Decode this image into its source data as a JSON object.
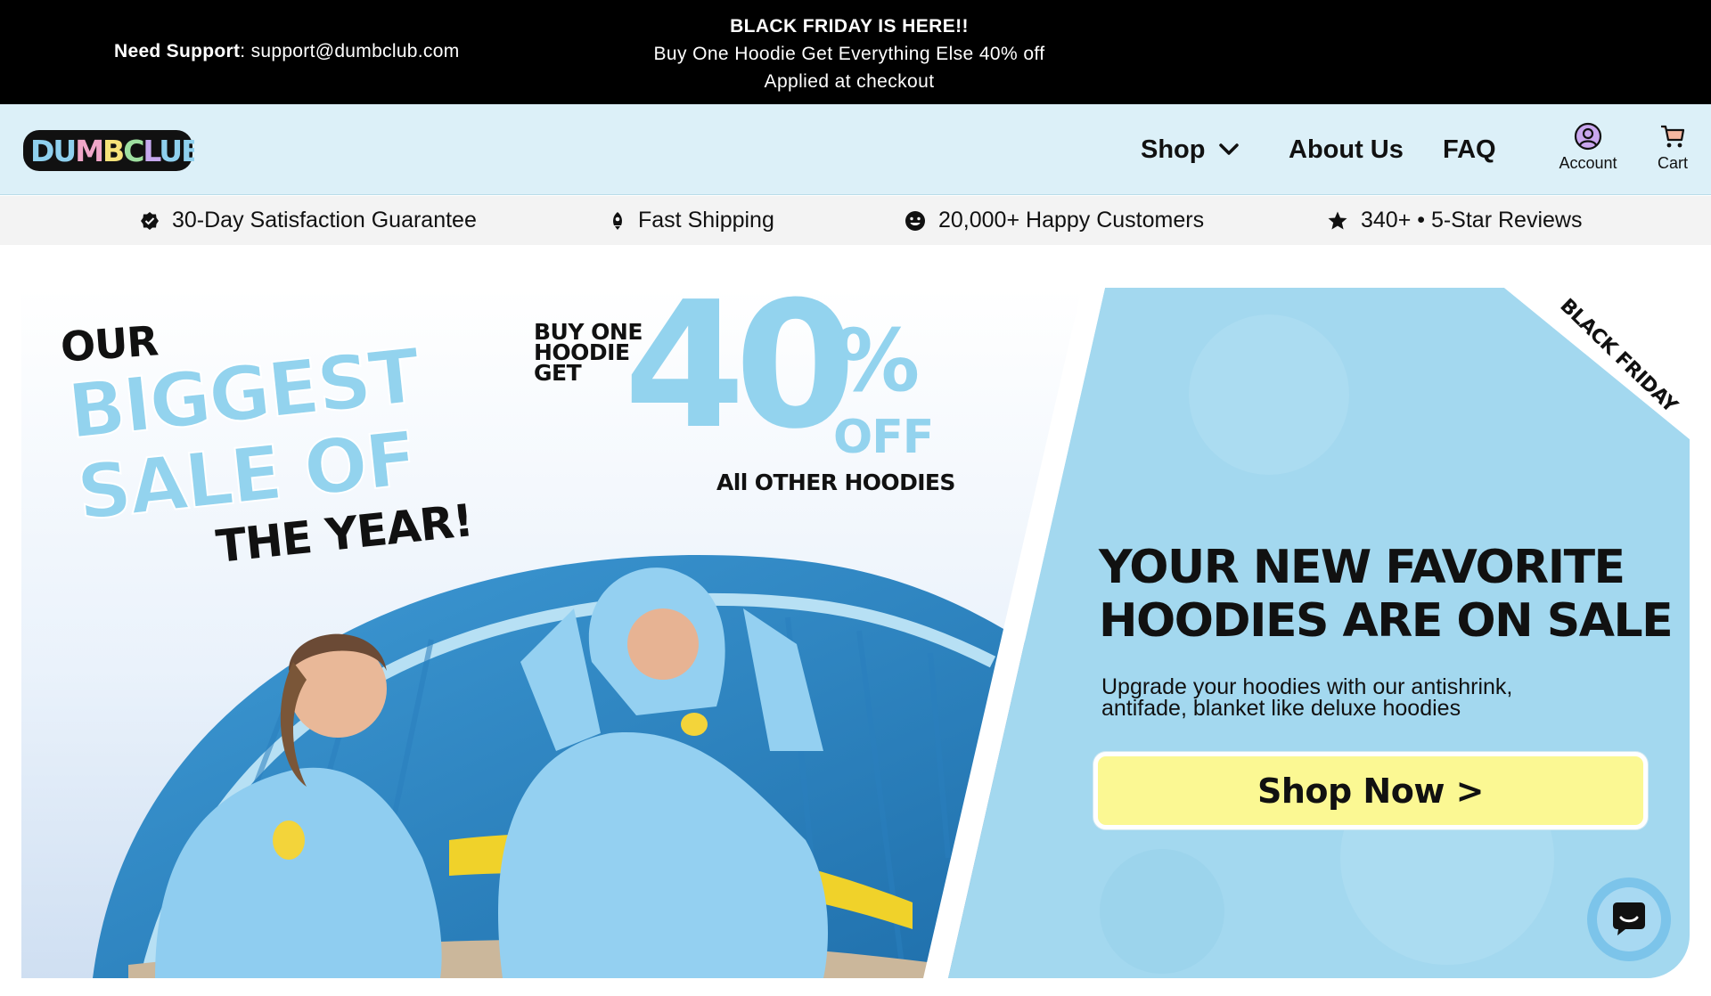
{
  "announcement": {
    "support_label": "Need Support",
    "support_sep": ":",
    "support_email": "support@dumbclub.com",
    "promo_line1": "BLACK FRIDAY IS HERE!!",
    "promo_line2": "Buy One Hoodie Get Everything Else 40% off",
    "promo_line3": "Applied at checkout"
  },
  "header": {
    "logo_text": "DUMBCLUB",
    "nav": [
      {
        "label": "Shop",
        "has_dropdown": true
      },
      {
        "label": "About Us"
      },
      {
        "label": "FAQ"
      }
    ],
    "account_label": "Account",
    "cart_label": "Cart"
  },
  "benefits": [
    {
      "icon": "verified-badge-icon",
      "label": "30-Day Satisfaction Guarantee"
    },
    {
      "icon": "rocket-icon",
      "label": "Fast Shipping"
    },
    {
      "icon": "smiley-icon",
      "label": "20,000+ Happy Customers"
    },
    {
      "icon": "star-icon",
      "label": "340+ • 5-Star Reviews"
    }
  ],
  "hero": {
    "our": "OUR",
    "biggest": "BIGGEST",
    "sale_of": "SALE OF",
    "the_year": "THE YEAR!",
    "buy_one": [
      "BUY ONE",
      "HOODIE",
      "GET"
    ],
    "forty": "40",
    "percent": "%",
    "off": "OFF",
    "all_other": "All OTHER HOODIES",
    "ribbon": "BLACK FRIDAY",
    "title_line1": "YOUR NEW FAVORITE",
    "title_line2": "HOODIES ARE ON SALE",
    "subtitle_line1": "Upgrade your hoodies with our antishrink,",
    "subtitle_line2": "antifade, blanket like deluxe hoodies",
    "cta_label": "Shop Now >"
  },
  "colors": {
    "announcement_bg": "#000000",
    "header_bg": "#dcf0f8",
    "benefits_bg": "#f3f3f3",
    "hero_blue": "#93d3ee",
    "cta_bg": "#fbf893",
    "panel_blue": "#a3d8ef"
  }
}
